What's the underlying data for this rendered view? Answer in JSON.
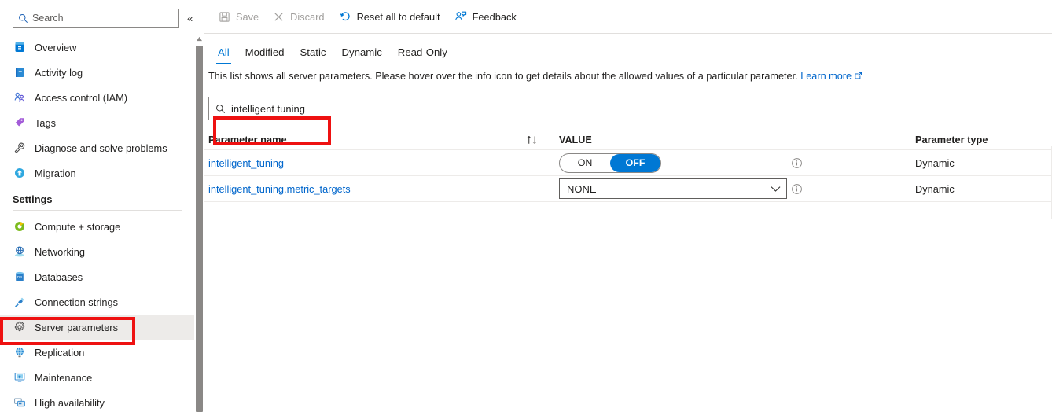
{
  "sidebar": {
    "search": {
      "placeholder": "Search",
      "icon": "search-icon"
    },
    "collapse_label": "«",
    "items_top": [
      {
        "label": "Overview",
        "icon": "overview-icon"
      },
      {
        "label": "Activity log",
        "icon": "activity-log-icon"
      },
      {
        "label": "Access control (IAM)",
        "icon": "access-control-icon"
      },
      {
        "label": "Tags",
        "icon": "tags-icon"
      },
      {
        "label": "Diagnose and solve problems",
        "icon": "wrench-icon"
      },
      {
        "label": "Migration",
        "icon": "migration-icon"
      }
    ],
    "group_title": "Settings",
    "items_settings": [
      {
        "label": "Compute + storage",
        "icon": "compute-storage-icon"
      },
      {
        "label": "Networking",
        "icon": "networking-icon"
      },
      {
        "label": "Databases",
        "icon": "databases-icon"
      },
      {
        "label": "Connection strings",
        "icon": "connection-strings-icon"
      },
      {
        "label": "Server parameters",
        "icon": "gear-icon",
        "selected": true
      },
      {
        "label": "Replication",
        "icon": "replication-icon"
      },
      {
        "label": "Maintenance",
        "icon": "maintenance-icon"
      },
      {
        "label": "High availability",
        "icon": "high-availability-icon"
      }
    ]
  },
  "toolbar": {
    "save_label": "Save",
    "discard_label": "Discard",
    "reset_label": "Reset all to default",
    "feedback_label": "Feedback"
  },
  "tabs": [
    {
      "label": "All",
      "active": true
    },
    {
      "label": "Modified",
      "active": false
    },
    {
      "label": "Static",
      "active": false
    },
    {
      "label": "Dynamic",
      "active": false
    },
    {
      "label": "Read-Only",
      "active": false
    }
  ],
  "description": {
    "text": "This list shows all server parameters. Please hover over the info icon to get details about the allowed values of a particular parameter. ",
    "link_label": "Learn more"
  },
  "filter": {
    "value": "intelligent tuning",
    "icon": "search-icon"
  },
  "table": {
    "headers": {
      "parameter_name": "Parameter name",
      "value": "VALUE",
      "parameter_type": "Parameter type"
    },
    "rows": [
      {
        "name": "intelligent_tuning",
        "control": "toggle",
        "toggle_off_label": "OFF",
        "toggle_on_label": "ON",
        "toggle_state": "OFF",
        "type": "Dynamic"
      },
      {
        "name": "intelligent_tuning.metric_targets",
        "control": "dropdown",
        "dropdown_value": "NONE",
        "type": "Dynamic"
      }
    ]
  },
  "colors": {
    "accent": "#0078d4",
    "link": "#0066cc",
    "annotation": "#ee1111",
    "selected_row": "#edebe9",
    "border": "#8a8886"
  }
}
